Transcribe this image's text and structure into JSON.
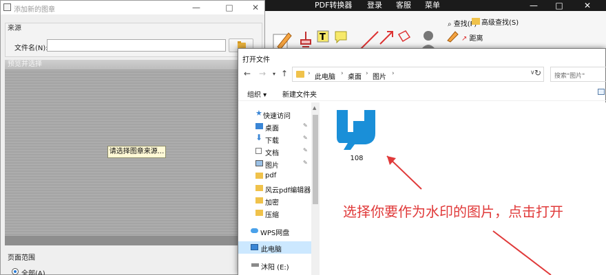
{
  "stamp_dialog": {
    "title": "添加新的图章",
    "minimize": "—",
    "maximize": "□",
    "close": "✕",
    "source_label": "来源",
    "file_name_label": "文件名(N):",
    "file_name_value": "",
    "preview_label": "预览并选择",
    "select_source_button": "请选择图章来源...",
    "page_range_label": "页面范围",
    "all_pages_label": "全部(A)"
  },
  "pdf_app": {
    "menus": [
      "PDF转换器",
      "登录",
      "客服",
      "菜单"
    ],
    "find_label": "查找(F)",
    "advanced_find_label": "高级查找(S)",
    "distance_label": "距离",
    "window_controls": [
      "—",
      "□",
      "✕"
    ]
  },
  "open_dialog": {
    "title": "打开文件",
    "breadcrumbs": [
      "此电脑",
      "桌面",
      "图片"
    ],
    "search_placeholder": "搜索\"图片\"",
    "organize_label": "组织 ▾",
    "new_folder_label": "新建文件夹",
    "nav_items": [
      {
        "label": "快速访问",
        "icon": "star-icon",
        "pinned": false
      },
      {
        "label": "桌面",
        "icon": "desktop-icon",
        "pinned": true
      },
      {
        "label": "下载",
        "icon": "download-icon",
        "pinned": true
      },
      {
        "label": "文档",
        "icon": "document-icon",
        "pinned": true
      },
      {
        "label": "图片",
        "icon": "pictures-icon",
        "pinned": true
      },
      {
        "label": "pdf",
        "icon": "folder-icon",
        "pinned": false
      },
      {
        "label": "风云pdf编辑器",
        "icon": "folder-icon",
        "pinned": false
      },
      {
        "label": "加密",
        "icon": "folder-icon",
        "pinned": false
      },
      {
        "label": "压缩",
        "icon": "folder-icon",
        "pinned": false
      },
      {
        "label": "WPS网盘",
        "icon": "cloud-icon",
        "pinned": false
      },
      {
        "label": "此电脑",
        "icon": "computer-icon",
        "pinned": false
      },
      {
        "label": "沐阳 (E:)",
        "icon": "drive-icon",
        "pinned": false
      }
    ],
    "file": {
      "name": "108"
    }
  },
  "instruction": "选择你要作为水印的图片，点击打开",
  "colors": {
    "annotation": "#e03a3a",
    "logo_blue": "#1a8fd8",
    "selection": "#cce8ff"
  }
}
